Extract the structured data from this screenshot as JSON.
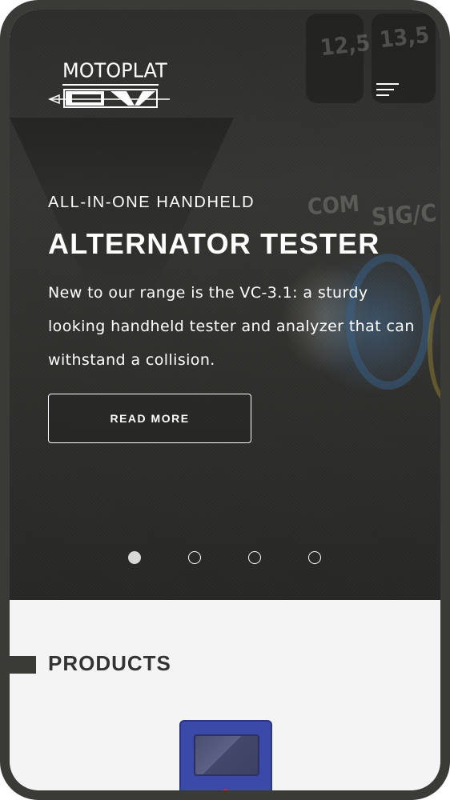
{
  "header": {
    "logo_text": "MOTOPLAT",
    "logo_mark": "CV",
    "menu_icon": "hamburger-menu-icon"
  },
  "hero": {
    "eyebrow": "ALL-IN-ONE HANDHELD",
    "title": "ALTERNATOR TESTER",
    "description": "New to our range is the VC-3.1: a sturdy looking handheld tester and analyzer that can withstand a collision.",
    "cta_label": "READ MORE",
    "background_labels": [
      "12,5",
      "13,5",
      "COM",
      "SIG/C"
    ],
    "slides_total": 4,
    "slide_active": 1
  },
  "products": {
    "title": "PRODUCTS"
  },
  "colors": {
    "frame": "#3a3a36",
    "hero_bg": "#2f2f2c",
    "section_bg": "#f4f4f4",
    "heading_text": "#333333",
    "product_blue": "#3b4aa8"
  }
}
